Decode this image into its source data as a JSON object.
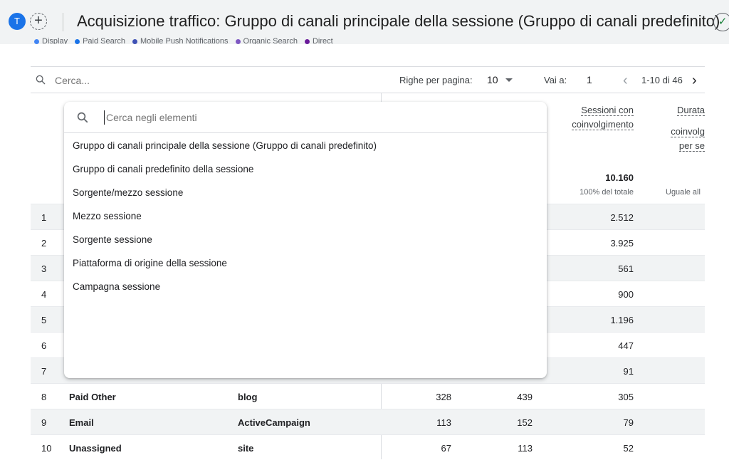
{
  "header": {
    "avatar_letter": "T",
    "add_symbol": "+",
    "title": "Acquisizione traffico: Gruppo di canali principale della sessione (Gruppo di canali predefinito)",
    "check_symbol": "✓"
  },
  "legend": {
    "items": [
      {
        "label": "Display",
        "color": "#4285f4"
      },
      {
        "label": "Paid Search",
        "color": "#1a73e8"
      },
      {
        "label": "Mobile Push Notifications",
        "color": "#3f51b5"
      },
      {
        "label": "Organic Search",
        "color": "#7e57c2"
      },
      {
        "label": "Direct",
        "color": "#6a1b9a"
      }
    ]
  },
  "toolbar": {
    "search_placeholder": "Cerca...",
    "rows_label": "Righe per pagina:",
    "rows_value": "10",
    "goto_label": "Vai a:",
    "goto_value": "1",
    "prev_symbol": "‹",
    "page_info": "1-10 di 46",
    "next_symbol": "›"
  },
  "table": {
    "head_metric_3": [
      "Sessioni con",
      "coinvolgimento"
    ],
    "head_metric_4": [
      "Durata",
      "coinvolg",
      "per se"
    ],
    "total_value": "10.160",
    "total_sub": "100% del totale",
    "total_sub_4": "Uguale all",
    "rows": [
      {
        "idx": "1",
        "channel": "",
        "source": "",
        "m1": "",
        "m2": "",
        "m3": "2.512"
      },
      {
        "idx": "2",
        "channel": "",
        "source": "",
        "m1": "",
        "m2": "",
        "m3": "3.925"
      },
      {
        "idx": "3",
        "channel": "",
        "source": "",
        "m1": "",
        "m2": "",
        "m3": "561"
      },
      {
        "idx": "4",
        "channel": "",
        "source": "",
        "m1": "",
        "m2": "",
        "m3": "900"
      },
      {
        "idx": "5",
        "channel": "",
        "source": "",
        "m1": "",
        "m2": "",
        "m3": "1.196"
      },
      {
        "idx": "6",
        "channel": "",
        "source": "",
        "m1": "",
        "m2": "",
        "m3": "447"
      },
      {
        "idx": "7",
        "channel": "",
        "source": "",
        "m1": "",
        "m2": "",
        "m3": "91"
      },
      {
        "idx": "8",
        "channel": "Paid Other",
        "source": "blog",
        "m1": "328",
        "m2": "439",
        "m3": "305"
      },
      {
        "idx": "9",
        "channel": "Email",
        "source": "ActiveCampaign",
        "m1": "113",
        "m2": "152",
        "m3": "79"
      },
      {
        "idx": "10",
        "channel": "Unassigned",
        "source": "site",
        "m1": "67",
        "m2": "113",
        "m3": "52"
      }
    ]
  },
  "dropdown": {
    "search_placeholder": "Cerca negli elementi",
    "items": [
      "Gruppo di canali principale della sessione (Gruppo di canali predefinito)",
      "Gruppo di canali predefinito della sessione",
      "Sorgente/mezzo sessione",
      "Mezzo sessione",
      "Sorgente sessione",
      "Piattaforma di origine della sessione",
      "Campagna sessione"
    ]
  }
}
